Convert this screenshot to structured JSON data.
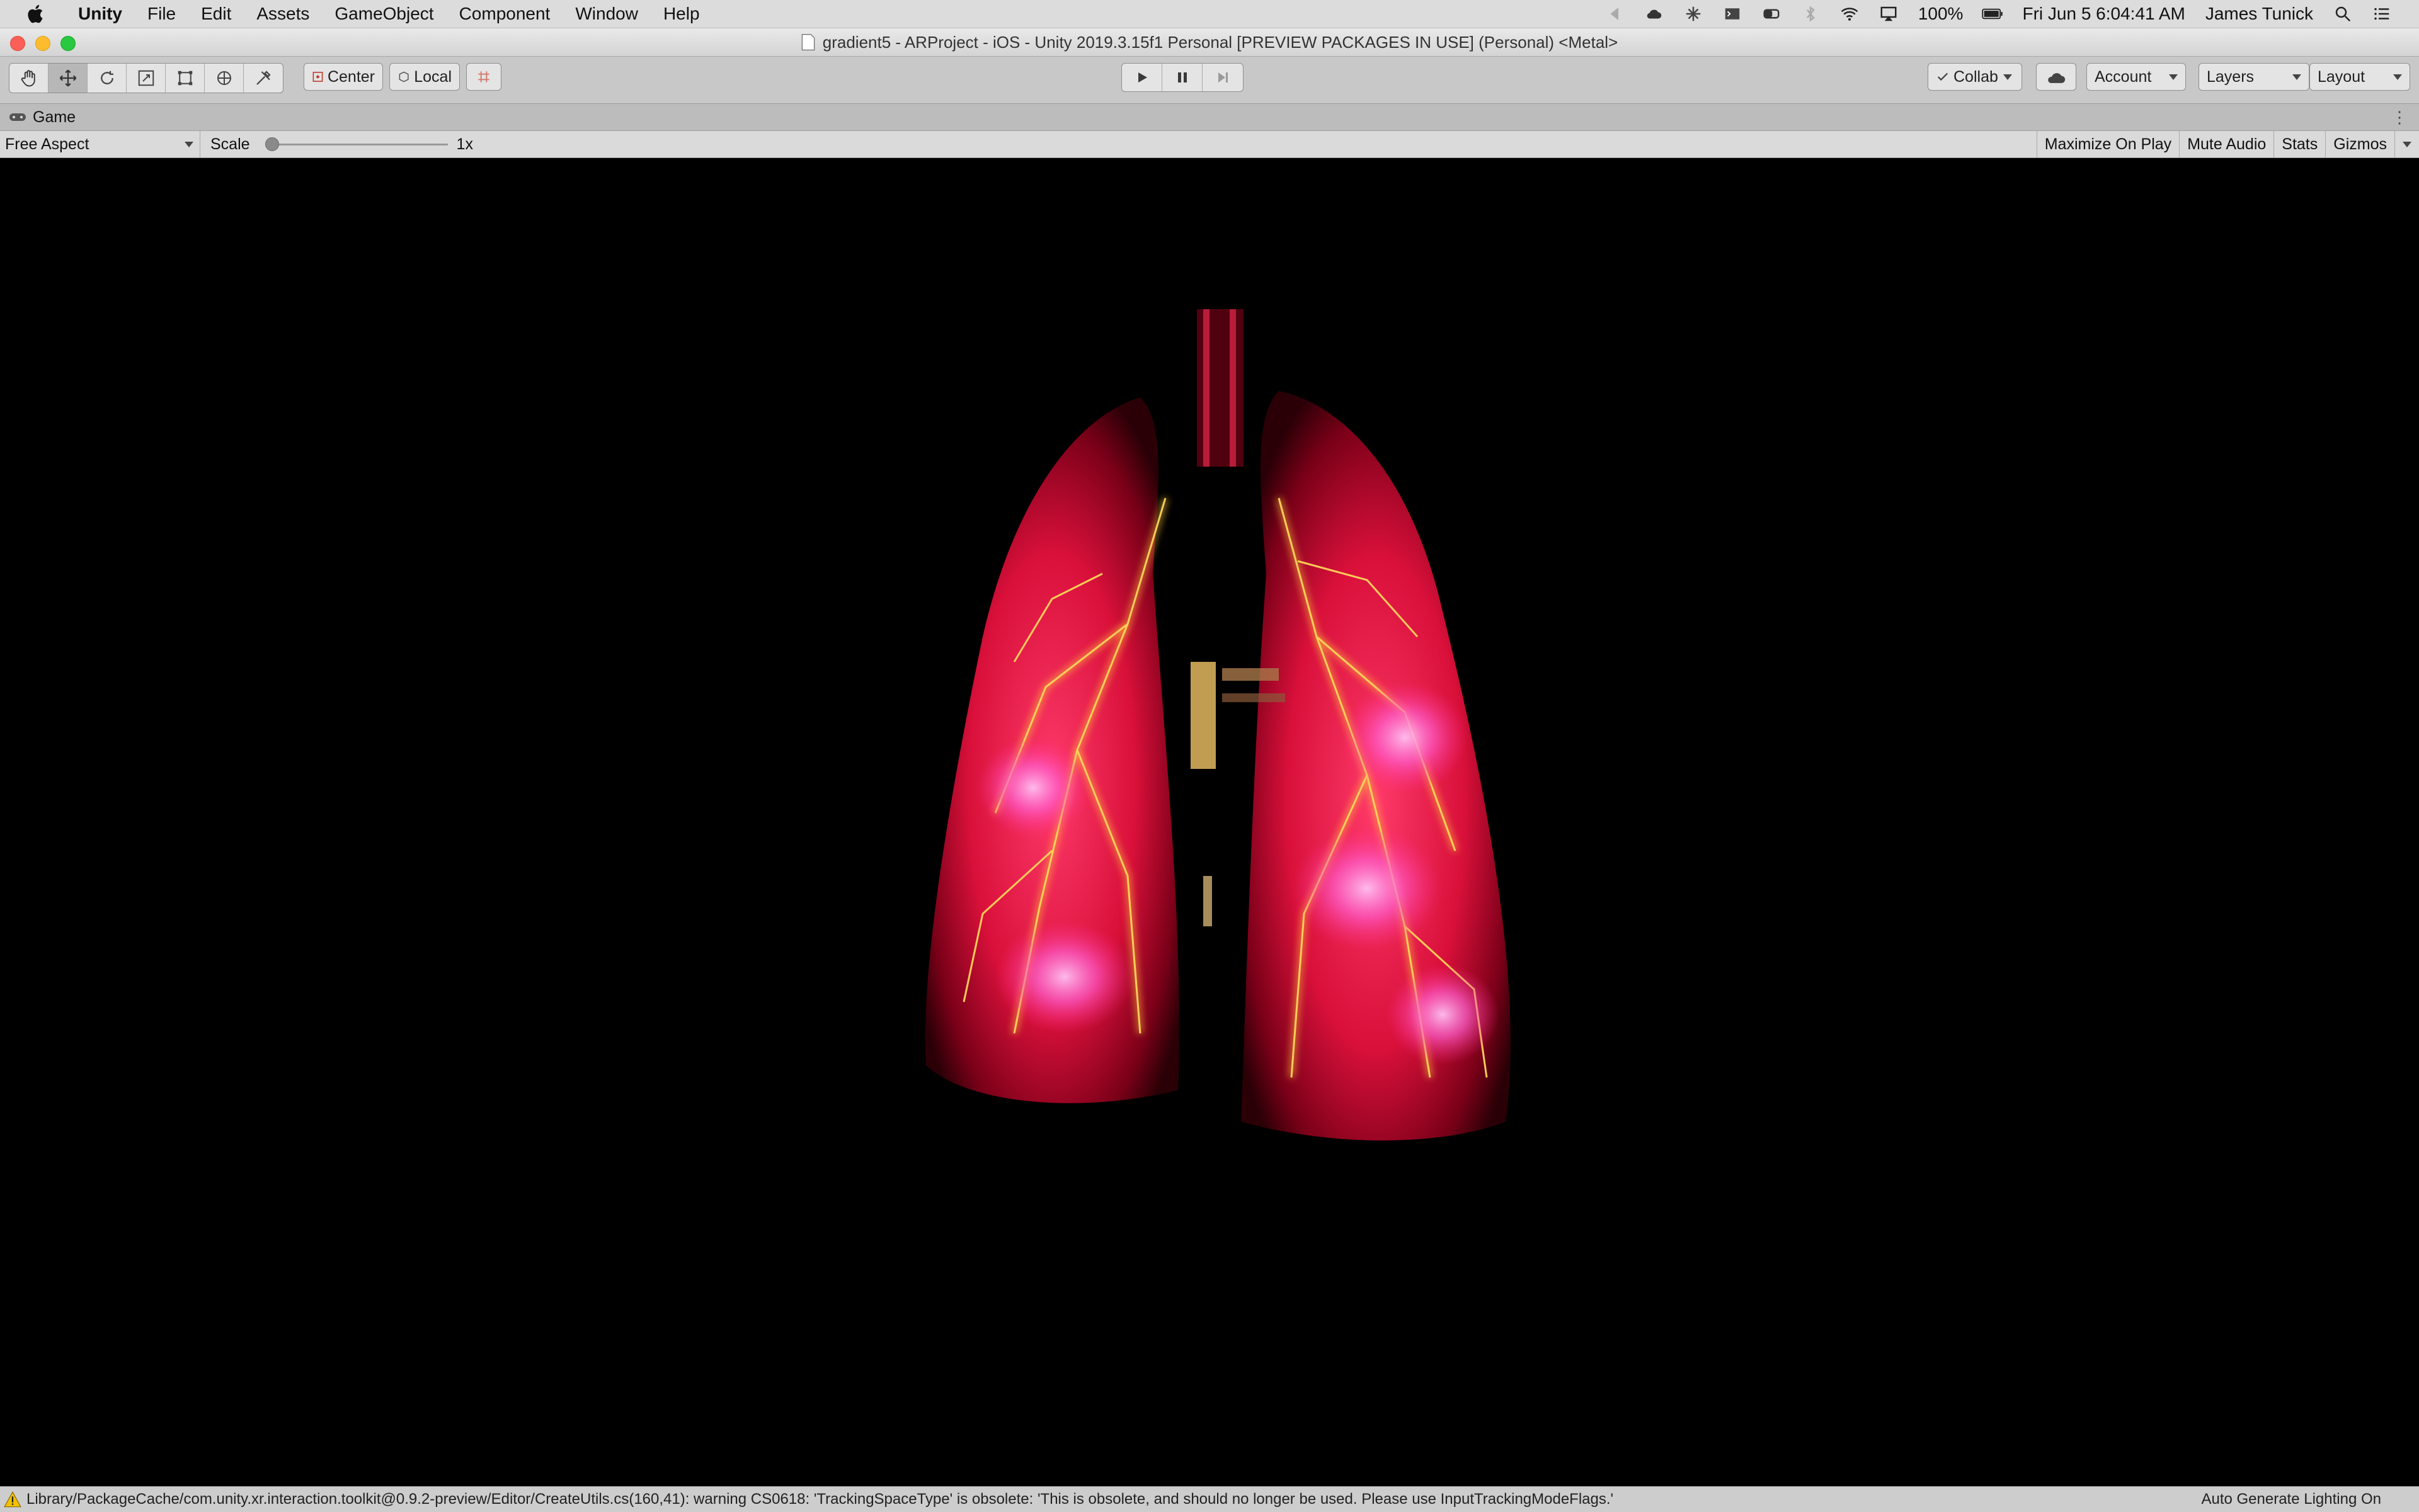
{
  "menubar": {
    "app_name": "Unity",
    "items": [
      "File",
      "Edit",
      "Assets",
      "GameObject",
      "Component",
      "Window",
      "Help"
    ],
    "battery": "100%",
    "clock": "Fri Jun 5  6:04:41 AM",
    "user": "James Tunick"
  },
  "window": {
    "title": "gradient5 - ARProject - iOS - Unity 2019.3.15f1 Personal [PREVIEW PACKAGES IN USE] (Personal) <Metal>"
  },
  "toolbar": {
    "pivot_label": "Center",
    "space_label": "Local",
    "collab_label": "Collab",
    "account_label": "Account",
    "layers_label": "Layers",
    "layout_label": "Layout"
  },
  "game_tab": {
    "label": "Game"
  },
  "game_bar": {
    "aspect": "Free Aspect",
    "scale_label": "Scale",
    "scale_value": "1x",
    "scale_fraction": 0,
    "maximize_label": "Maximize On Play",
    "mute_label": "Mute Audio",
    "stats_label": "Stats",
    "gizmos_label": "Gizmos"
  },
  "status": {
    "message": "Library/PackageCache/com.unity.xr.interaction.toolkit@0.9.2-preview/Editor/CreateUtils.cs(160,41): warning CS0618: 'TrackingSpaceType' is obsolete: 'This is obsolete, and should no longer be used.  Please use InputTrackingModeFlags.'",
    "lighting": "Auto Generate Lighting On"
  },
  "colors": {
    "play_accent": "#3a3a3a",
    "lung_red": "#e0103a",
    "lung_yellow": "#ffc43a",
    "lung_pink": "#ff6ad0",
    "warning_yellow": "#f2c200"
  },
  "icons": [
    "apple-icon",
    "hand-tool-icon",
    "move-tool-icon",
    "rotate-tool-icon",
    "scale-tool-icon",
    "rect-tool-icon",
    "transform-tool-icon",
    "custom-tool-icon",
    "play-icon",
    "pause-icon",
    "step-icon",
    "cloud-icon",
    "warning-icon"
  ]
}
